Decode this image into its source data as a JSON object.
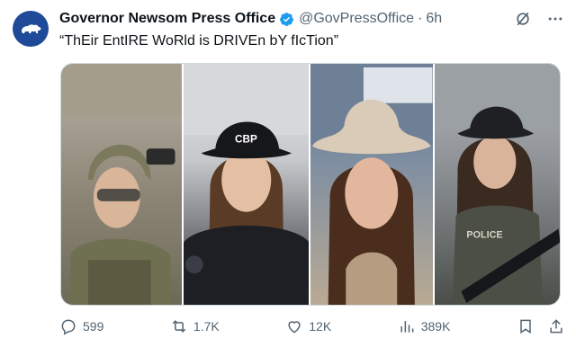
{
  "author": {
    "display_name": "Governor Newsom Press Office",
    "handle": "@GovPressOffice",
    "separator": "·",
    "time": "6h",
    "verified": true,
    "avatar_icon": "california-bear-icon",
    "avatar_color": "#1e4a99"
  },
  "tweet": {
    "text": "“ThEir EntIRE WoRld is DRIVEn bY fIcTion”"
  },
  "media": {
    "photos": [
      {
        "name": "photo-tactical-gear",
        "cap_text": ""
      },
      {
        "name": "photo-cbp-cap",
        "cap_text": "CBP"
      },
      {
        "name": "photo-cowboy-hat",
        "cap_text": ""
      },
      {
        "name": "photo-police-vest",
        "cap_text": "POLICE"
      }
    ]
  },
  "metrics": {
    "replies": "599",
    "reposts": "1.7K",
    "likes": "12K",
    "views": "389K"
  },
  "icons": {
    "reply": "reply-icon",
    "repost": "repost-icon",
    "like": "like-icon",
    "views": "views-icon",
    "bookmark": "bookmark-icon",
    "share": "share-icon",
    "grok": "grok-icon",
    "more": "more-icon"
  },
  "colors": {
    "verified": "#1d9bf0",
    "muted": "#536471",
    "text": "#0f1419"
  }
}
